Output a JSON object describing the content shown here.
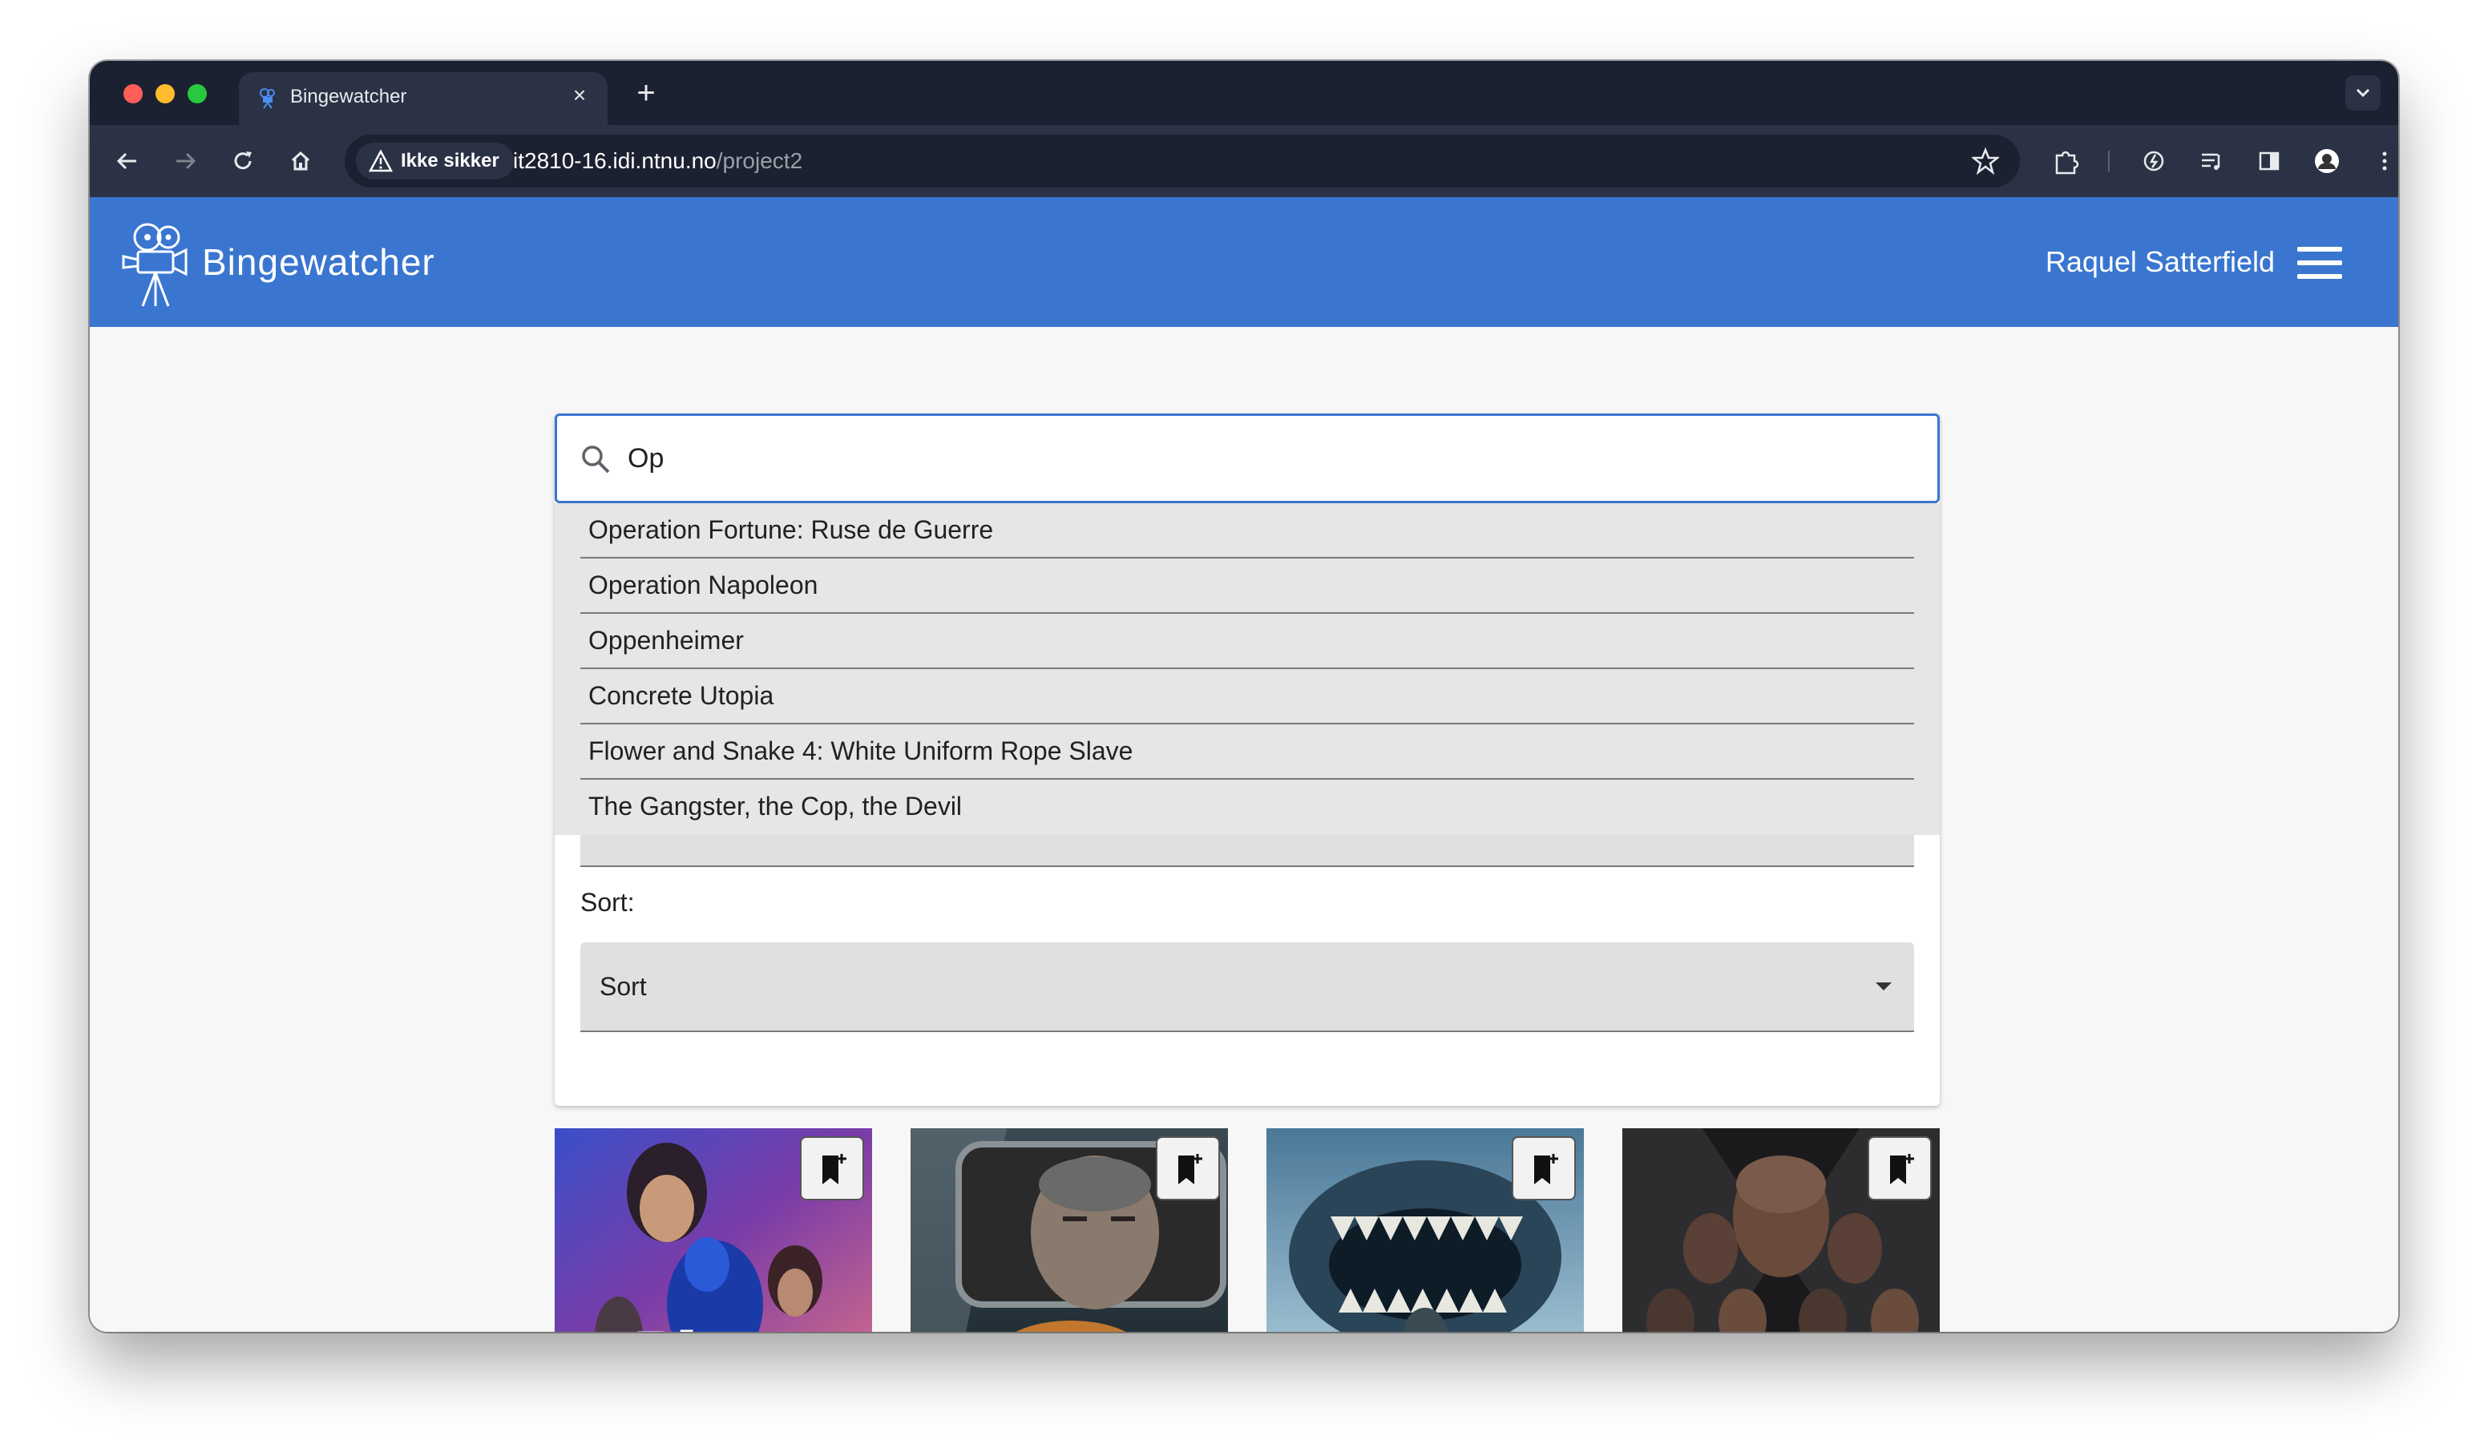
{
  "browser": {
    "tab_title": "Bingewatcher",
    "tab_close": "×",
    "new_tab": "+",
    "security_label": "Ikke sikker",
    "url_host": "it2810-16.idi.ntnu.no",
    "url_path": "/project2"
  },
  "app": {
    "brand": "Bingewatcher",
    "user_name": "Raquel Satterfield"
  },
  "search": {
    "value": "Op"
  },
  "suggestions": [
    "Operation Fortune: Ruse de Guerre",
    "Operation Napoleon",
    "Oppenheimer",
    "Concrete Utopia",
    "Flower and Snake 4: White Uniform Rope Slave",
    "The Gangster, the Cop, the Devil"
  ],
  "sort": {
    "label": "Sort:",
    "value": "Sort"
  },
  "colors": {
    "brand_blue": "#3a76d0",
    "browser_dark": "#1b2130",
    "browser_toolbar": "#2b3245"
  }
}
